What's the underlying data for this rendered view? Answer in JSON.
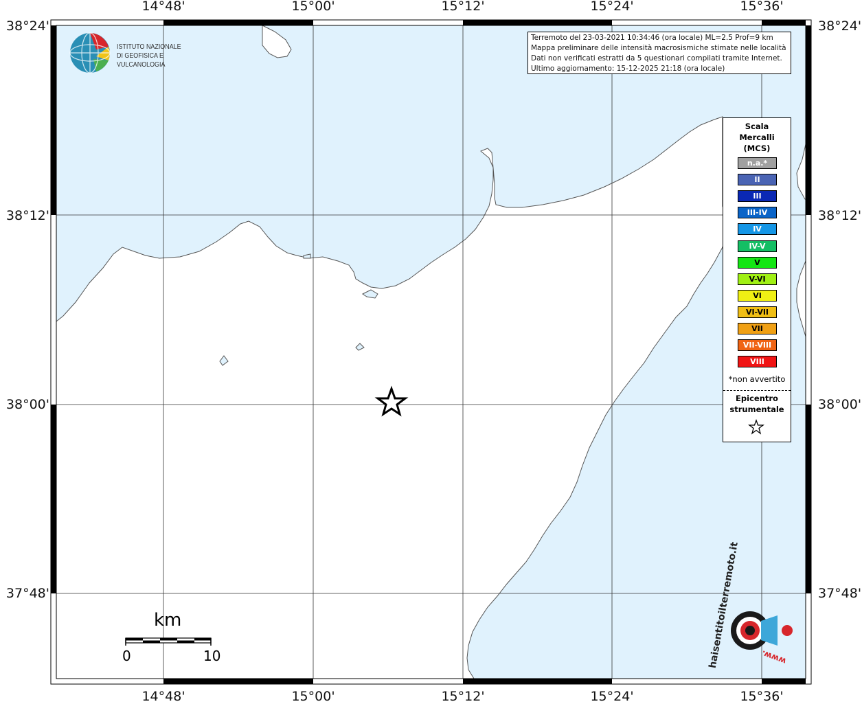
{
  "map": {
    "top_longitude_labels": [
      "14°48'",
      "15°00'",
      "15°12'",
      "15°24'",
      "15°36'"
    ],
    "bottom_longitude_labels": [
      "14°48'",
      "15°00'",
      "15°12'",
      "15°24'",
      "15°36'"
    ],
    "left_latitude_labels": [
      "38°24'",
      "38°12'",
      "38°00'",
      "37°48'"
    ],
    "right_latitude_labels": [
      "38°24'",
      "38°12'",
      "38°00'",
      "37°48'"
    ],
    "sea_color": "#e0f2fd",
    "land_color": "#ffffff",
    "epicenter_symbol": "star-icon"
  },
  "info": {
    "line1": "Terremoto del 23-03-2021 10:34:46 (ora locale) ML=2.5 Prof=9 km",
    "line2": "Mappa preliminare delle intensità macrosismiche stimate nelle località",
    "line3": "Dati non verificati estratti da 5 questionari compilati tramite Internet.",
    "line4": "Ultimo aggiornamento: 15-12-2025 21:18 (ora locale)"
  },
  "ingv_logo": {
    "line1": "ISTITUTO NAZIONALE",
    "line2": "DI GEOFISICA E VULCANOLOGIA"
  },
  "legend": {
    "title_line1": "Scala",
    "title_line2": "Mercalli",
    "title_line3": "(MCS)",
    "items": [
      {
        "label": "n.a.*",
        "color": "#a0a0a0"
      },
      {
        "label": "II",
        "color": "#4a64b4"
      },
      {
        "label": "III",
        "color": "#0a28b4"
      },
      {
        "label": "III-IV",
        "color": "#0a64c8"
      },
      {
        "label": "IV",
        "color": "#1496e6"
      },
      {
        "label": "IV-V",
        "color": "#14be64"
      },
      {
        "label": "V",
        "color": "#14e614"
      },
      {
        "label": "V-VI",
        "color": "#a0f014"
      },
      {
        "label": "VI",
        "color": "#f0f014"
      },
      {
        "label": "VI-VII",
        "color": "#f0be14"
      },
      {
        "label": "VII",
        "color": "#f0a014"
      },
      {
        "label": "VII-VIII",
        "color": "#f06414"
      },
      {
        "label": "VIII",
        "color": "#f01414"
      }
    ],
    "note": "*non avvertito",
    "epicenter_line1": "Epicentro",
    "epicenter_line2": "strumentale"
  },
  "scalebar": {
    "unit": "km",
    "start_label": "0",
    "end_label": "10"
  },
  "hst_logo": {
    "text": "haisentitoilterremoto.it",
    "url_text": "www."
  }
}
